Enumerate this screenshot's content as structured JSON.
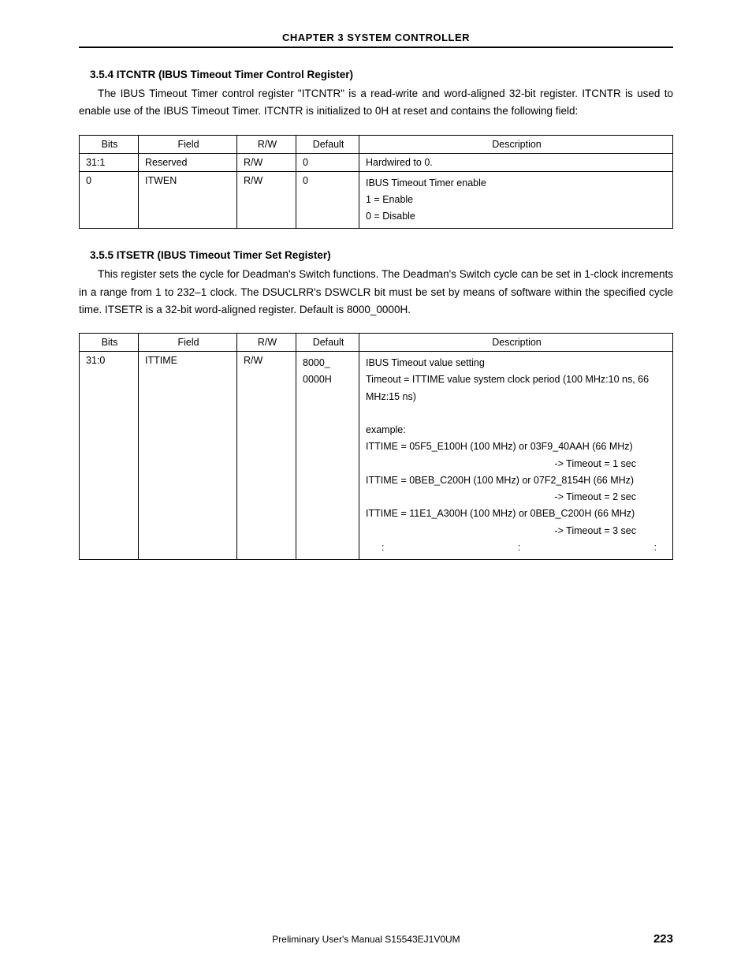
{
  "header": {
    "chapter_title": "CHAPTER  3   SYSTEM CONTROLLER"
  },
  "section1": {
    "heading": "3.5.4  ITCNTR (IBUS Timeout Timer Control Register)",
    "para1": "The IBUS Timeout Timer control register \"ITCNTR\" is a read-write and word-aligned 32-bit register. ITCNTR is used to enable use of the IBUS Timeout Timer. ITCNTR is initialized to 0H at reset and contains the following field:"
  },
  "table1": {
    "head": {
      "bits": "Bits",
      "field": "Field",
      "rw": "R/W",
      "def": "Default",
      "desc": "Description"
    },
    "rows": [
      {
        "bits": "31:1",
        "field": "Reserved",
        "rw": "R/W",
        "def": "0",
        "desc_lines": [
          "Hardwired to 0."
        ]
      },
      {
        "bits": "0",
        "field": "ITWEN",
        "rw": "R/W",
        "def": "0",
        "desc_lines": [
          "IBUS Timeout Timer enable",
          "1 = Enable",
          "0 = Disable"
        ]
      }
    ]
  },
  "section2": {
    "heading": "3.5.5  ITSETR (IBUS Timeout Timer Set Register)",
    "para1": "This register sets the cycle for Deadman's Switch functions. The Deadman's Switch cycle can be set in 1-clock increments in a range from 1 to 232–1 clock. The DSUCLRR's DSWCLR bit must be set by means of software within the specified cycle time. ITSETR is a 32-bit word-aligned register. Default is 8000_0000H."
  },
  "table2": {
    "head": {
      "bits": "Bits",
      "field": "Field",
      "rw": "R/W",
      "def": "Default",
      "desc": "Description"
    },
    "row": {
      "bits": "31:0",
      "field": "ITTIME",
      "rw": "R/W",
      "def_line1": "8000_",
      "def_line2": "0000H",
      "d1": "IBUS Timeout value setting",
      "d2": "Timeout = ITTIME value system clock period (100 MHz:10 ns, 66 MHz:15 ns)",
      "d3": "example:",
      "d4": "ITTIME = 05F5_E100H (100 MHz) or 03F9_40AAH (66 MHz)",
      "d5": "-> Timeout = 1 sec",
      "d6": "ITTIME = 0BEB_C200H (100 MHz) or 07F2_8154H (66 MHz)",
      "d7": "-> Timeout = 2 sec",
      "d8": "ITTIME = 11E1_A300H (100 MHz) or 0BEB_C200H (66 MHz)",
      "d9": "-> Timeout = 3 sec",
      "colon": ":"
    }
  },
  "footer": {
    "left": "Preliminary User's Manual  S15543EJ1V0UM",
    "page": "223"
  }
}
